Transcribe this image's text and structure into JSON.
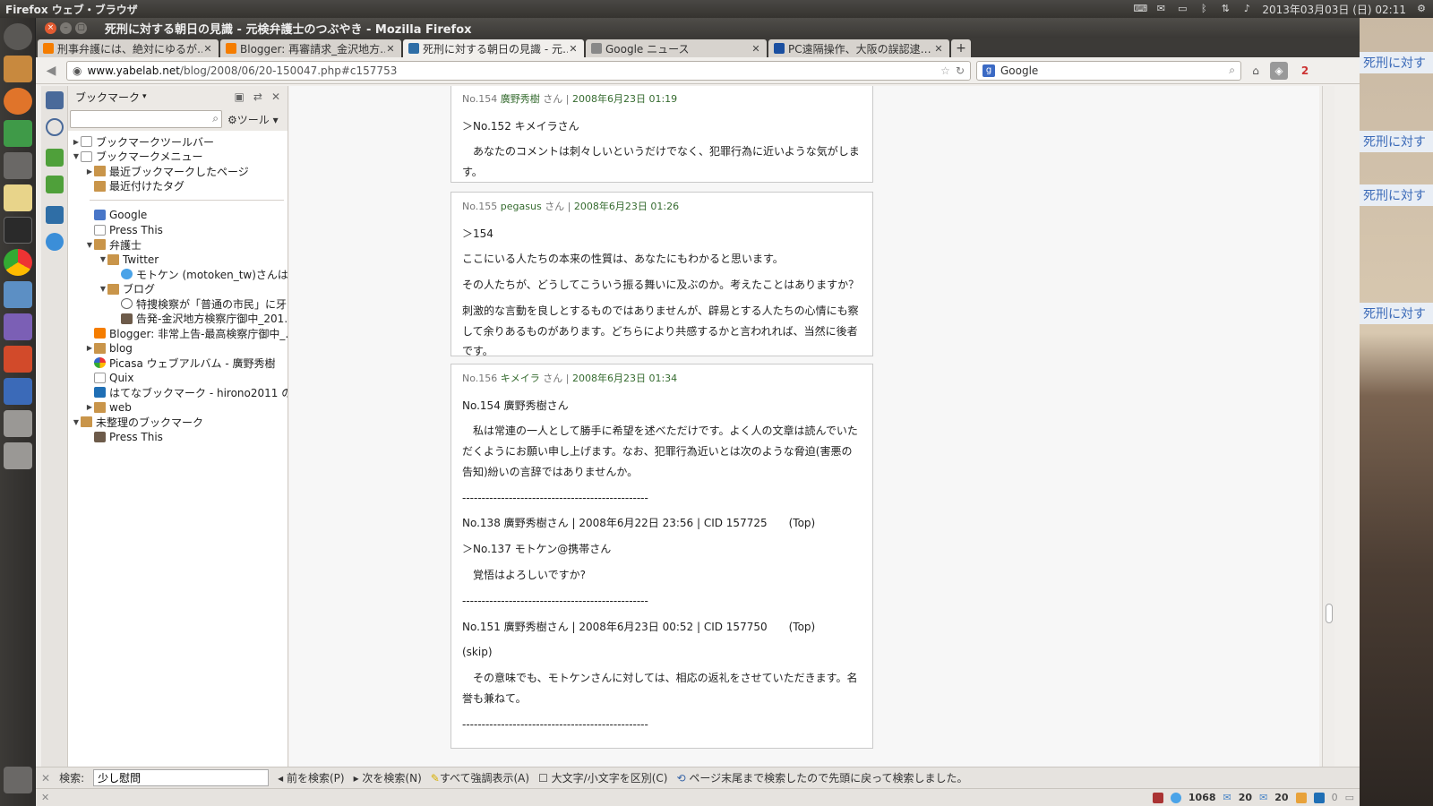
{
  "panel": {
    "app_name": "Firefox ウェブ・ブラウザ",
    "datetime": "2013年03月03日 (日) 02:11"
  },
  "window": {
    "title": "死刑に対する朝日の見識 - 元検弁護士のつぶやき - Mozilla Firefox"
  },
  "tabs": [
    {
      "label": "刑事弁護には、絶対にゆるが…",
      "favicon_color": "#f57d00",
      "active": false
    },
    {
      "label": "Blogger: 再審請求_金沢地方…",
      "favicon_color": "#f57d00",
      "active": false
    },
    {
      "label": "死刑に対する朝日の見識 - 元…",
      "favicon_color": "#2f6ea6",
      "active": true
    },
    {
      "label": "Google ニュース",
      "favicon_color": "#888888",
      "active": false
    },
    {
      "label": "PC遠隔操作、大阪の誤認逮…",
      "favicon_color": "#1a4fa0",
      "active": false
    }
  ],
  "navbar": {
    "url_host": "www.yabelab.net",
    "url_path": "/blog/2008/06/20-150047.php#c157753",
    "search_engine": "Google",
    "notification_count": "2"
  },
  "sidebar": {
    "title": "ブックマーク",
    "tools_label": "ツール",
    "tree": [
      {
        "label": "ブックマークツールバー",
        "depth": 0,
        "icon": "page",
        "twisty": "▶"
      },
      {
        "label": "ブックマークメニュー",
        "depth": 0,
        "icon": "page",
        "twisty": "▼"
      },
      {
        "label": "最近ブックマークしたページ",
        "depth": 1,
        "icon": "folder",
        "twisty": "▶"
      },
      {
        "label": "最近付けたタグ",
        "depth": 1,
        "icon": "folder",
        "twisty": ""
      },
      {
        "label": "",
        "separator": true
      },
      {
        "label": "Google",
        "depth": 1,
        "icon": "g",
        "twisty": ""
      },
      {
        "label": "Press This",
        "depth": 1,
        "icon": "page",
        "twisty": ""
      },
      {
        "label": "弁護士",
        "depth": 1,
        "icon": "folder",
        "twisty": "▼"
      },
      {
        "label": "Twitter",
        "depth": 2,
        "icon": "folder",
        "twisty": "▼"
      },
      {
        "label": "モトケン (motoken_tw)さんはT…",
        "depth": 3,
        "icon": "tw-ic",
        "twisty": ""
      },
      {
        "label": "ブログ",
        "depth": 2,
        "icon": "folder",
        "twisty": "▼"
      },
      {
        "label": "特捜検察が「普通の市民」に牙…",
        "depth": 3,
        "icon": "wp",
        "twisty": ""
      },
      {
        "label": "告発-金沢地方検察庁御中_201…",
        "depth": 3,
        "icon": "img",
        "twisty": ""
      },
      {
        "label": "Blogger: 非常上告-最高検察庁御中_…",
        "depth": 1,
        "icon": "blg",
        "twisty": ""
      },
      {
        "label": "blog",
        "depth": 1,
        "icon": "folder",
        "twisty": "▶"
      },
      {
        "label": "Picasa ウェブアルバム - 廣野秀樹",
        "depth": 1,
        "icon": "pic",
        "twisty": ""
      },
      {
        "label": "Quix",
        "depth": 1,
        "icon": "page",
        "twisty": ""
      },
      {
        "label": "はてなブックマーク - hirono2011 のブ…",
        "depth": 1,
        "icon": "hb",
        "twisty": ""
      },
      {
        "label": "web",
        "depth": 1,
        "icon": "folder",
        "twisty": "▶"
      },
      {
        "label": "未整理のブックマーク",
        "depth": 0,
        "icon": "folder",
        "twisty": "▼"
      },
      {
        "label": "Press This",
        "depth": 1,
        "icon": "img",
        "twisty": ""
      }
    ]
  },
  "comments": [
    {
      "no": "No.154",
      "author": "廣野秀樹",
      "san": "さん",
      "date": "2008年6月23日 01:19",
      "lines": [
        {
          "text": "＞No.152 キメイラさん",
          "indent": false
        },
        {
          "text": "あなたのコメントは刺々しいというだけでなく、犯罪行為に近いような気がします。",
          "indent": true
        }
      ]
    },
    {
      "no": "No.155",
      "author": "pegasus",
      "san": "さん",
      "date": "2008年6月23日 01:26",
      "lines": [
        {
          "text": "＞154",
          "indent": false
        },
        {
          "text": "ここにいる人たちの本来の性質は、あなたにもわかると思います。",
          "indent": false
        },
        {
          "text": "その人たちが、どうしてこういう振る舞いに及ぶのか。考えたことはありますか？",
          "indent": false
        },
        {
          "text": "刺激的な言動を良しとするものではありませんが、辟易とする人たちの心情にも察して余りあるものがあります。どちらにより共感するかと言われれば、当然に後者です。",
          "indent": false
        }
      ]
    },
    {
      "no": "No.156",
      "author": "キメイラ",
      "san": "さん",
      "date": "2008年6月23日 01:34",
      "lines": [
        {
          "text": "No.154 廣野秀樹さん",
          "indent": false
        },
        {
          "text": "私は常連の一人として勝手に希望を述べただけです。よく人の文章は読んでいただくようにお願い申し上げます。なお、犯罪行為近いとは次のような脅迫(害悪の告知)紛いの言辞ではありませんか。",
          "indent": true
        },
        {
          "text": "------------------------------------------------",
          "indent": false
        },
        {
          "text": "No.138 廣野秀樹さん | 2008年6月22日 23:56 | CID 157725　　(Top)",
          "indent": false
        },
        {
          "text": "＞No.137 モトケン@携帯さん",
          "indent": false
        },
        {
          "text": "覚悟はよろしいですか?",
          "indent": true
        },
        {
          "text": "------------------------------------------------",
          "indent": false
        },
        {
          "text": "No.151 廣野秀樹さん | 2008年6月23日 00:52 | CID 157750　　(Top)",
          "indent": false
        },
        {
          "text": "(skip)",
          "indent": false
        },
        {
          "text": "その意味でも、モトケンさんに対しては、相応の返礼をさせていただきます。名誉も兼ねて。",
          "indent": true
        },
        {
          "text": "------------------------------------------------",
          "indent": false
        }
      ]
    }
  ],
  "findbar": {
    "label": "検索:",
    "query": "少し慰問",
    "prev": "前を検索(P)",
    "next": "次を検索(N)",
    "highlight": "すべて強調表示(A)",
    "match_case": "大文字/小文字を区別(C)",
    "message": "ページ末尾まで検索したので先頭に戻って検索しました。"
  },
  "statusbar": {
    "count1": "1068",
    "count2": "20",
    "count3": "20",
    "count4": "0"
  },
  "desktop_snippet": "死刑に対す"
}
